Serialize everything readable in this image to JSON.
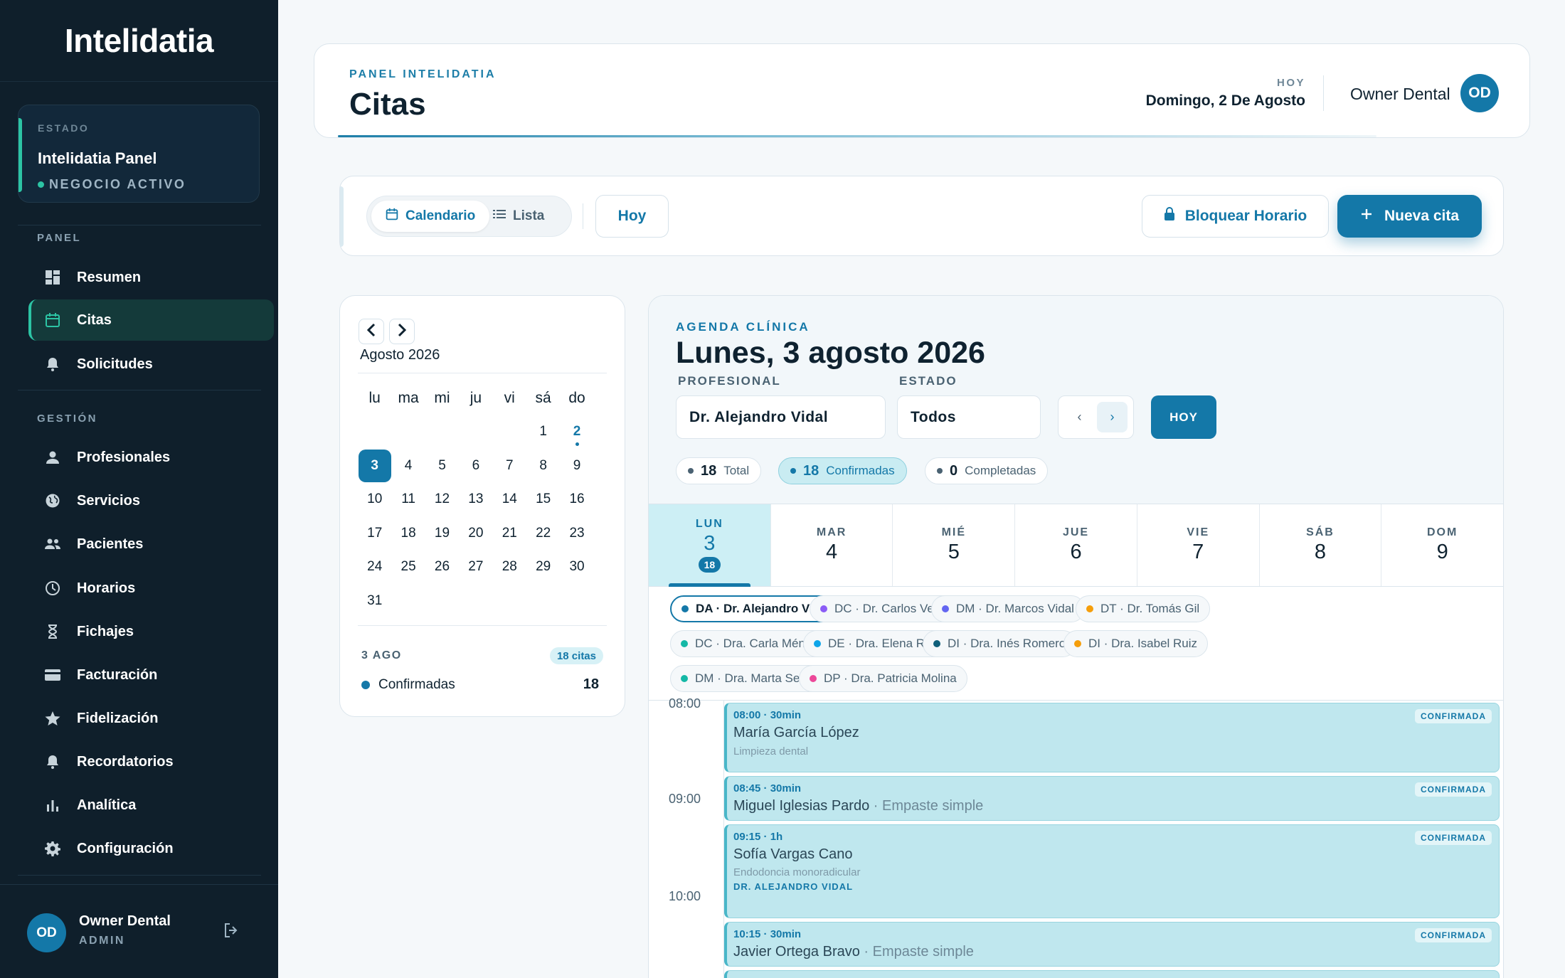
{
  "sidebar": {
    "logo": "Intelidatia",
    "status": {
      "label": "ESTADO",
      "name": "Intelidatia Panel",
      "badge": "NEGOCIO ACTIVO"
    },
    "panel_heading": "PANEL",
    "panel_items": [
      {
        "label": "Resumen",
        "icon": "dashboard-icon"
      },
      {
        "label": "Citas",
        "icon": "calendar-icon",
        "active": true
      },
      {
        "label": "Solicitudes",
        "icon": "bell-icon"
      }
    ],
    "gestion_heading": "GESTIÓN",
    "gestion_items": [
      {
        "label": "Profesionales",
        "icon": "person-icon"
      },
      {
        "label": "Servicios",
        "icon": "globe-icon"
      },
      {
        "label": "Pacientes",
        "icon": "people-icon"
      },
      {
        "label": "Horarios",
        "icon": "clock-icon"
      },
      {
        "label": "Fichajes",
        "icon": "hourglass-icon"
      },
      {
        "label": "Facturación",
        "icon": "card-icon"
      },
      {
        "label": "Fidelización",
        "icon": "star-icon"
      },
      {
        "label": "Recordatorios",
        "icon": "bell-icon"
      },
      {
        "label": "Analítica",
        "icon": "bar-chart-icon"
      },
      {
        "label": "Configuración",
        "icon": "gear-icon"
      }
    ],
    "footer": {
      "initials": "OD",
      "name": "Owner Dental",
      "role": "ADMIN"
    }
  },
  "header": {
    "eyebrow": "PANEL INTELIDATIA",
    "title": "Citas",
    "today_label": "HOY",
    "today_value": "Domingo, 2 De Agosto",
    "owner": "Owner Dental",
    "initials": "OD"
  },
  "toolbar": {
    "calendar": "Calendario",
    "list": "Lista",
    "today": "Hoy",
    "block": "Bloquear Horario",
    "new": "Nueva cita"
  },
  "mini_calendar": {
    "month": "Agosto 2026",
    "weekdays": [
      "lu",
      "ma",
      "mi",
      "ju",
      "vi",
      "sá",
      "do"
    ],
    "weeks": [
      [
        "",
        "",
        "",
        "",
        "",
        "1",
        "2"
      ],
      [
        "3",
        "4",
        "5",
        "6",
        "7",
        "8",
        "9"
      ],
      [
        "10",
        "11",
        "12",
        "13",
        "14",
        "15",
        "16"
      ],
      [
        "17",
        "18",
        "19",
        "20",
        "21",
        "22",
        "23"
      ],
      [
        "24",
        "25",
        "26",
        "27",
        "28",
        "29",
        "30"
      ],
      [
        "31",
        "",
        "",
        "",
        "",
        "",
        ""
      ]
    ],
    "selected": "3",
    "today": "2",
    "summary": {
      "date": "3 AGO",
      "badge": "18 citas",
      "label": "Confirmadas",
      "count": "18"
    }
  },
  "agenda": {
    "eyebrow": "AGENDA CLÍNICA",
    "title": "Lunes, 3 agosto 2026",
    "profesional_label": "PROFESIONAL",
    "profesional_value": "Dr. Alejandro Vidal",
    "estado_label": "ESTADO",
    "estado_value": "Todos",
    "today_btn": "HOY",
    "stats": [
      {
        "num": "18",
        "label": "Total"
      },
      {
        "num": "18",
        "label": "Confirmadas",
        "active": true
      },
      {
        "num": "0",
        "label": "Completadas"
      }
    ],
    "days": [
      {
        "name": "LUN",
        "num": "3",
        "count": "18",
        "active": true
      },
      {
        "name": "MAR",
        "num": "4"
      },
      {
        "name": "MIÉ",
        "num": "5"
      },
      {
        "name": "JUE",
        "num": "6"
      },
      {
        "name": "VIE",
        "num": "7"
      },
      {
        "name": "SÁB",
        "num": "8"
      },
      {
        "name": "DOM",
        "num": "9"
      }
    ],
    "professionals": [
      {
        "label": "DA · Dr. Alejandro Vidal",
        "color": "#1478a8",
        "active": true
      },
      {
        "label": "DC · Dr. Carlos Vega",
        "color": "#8b5cf6"
      },
      {
        "label": "DM · Dr. Marcos Vidal",
        "color": "#6366f1"
      },
      {
        "label": "DT · Dr. Tomás Gil",
        "color": "#f59e0b"
      },
      {
        "label": "DC · Dra. Carla Méndez",
        "color": "#14b8a6"
      },
      {
        "label": "DE · Dra. Elena Ruiz",
        "color": "#0ea5e9"
      },
      {
        "label": "DI · Dra. Inés Romero",
        "color": "#0f5f7a"
      },
      {
        "label": "DI · Dra. Isabel Ruiz",
        "color": "#f59e0b"
      },
      {
        "label": "DM · Dra. Marta Serrano",
        "color": "#14b8a6"
      },
      {
        "label": "DP · Dra. Patricia Molina",
        "color": "#ec4899"
      }
    ],
    "times": [
      "08:00",
      "09:00",
      "10:00"
    ],
    "appointments": [
      {
        "time": "08:00 · 30min",
        "patient": "María García López",
        "service": "",
        "sub": "Limpieza dental",
        "doctor": "",
        "status": "CONFIRMADA"
      },
      {
        "time": "08:45 · 30min",
        "patient": "Miguel Iglesias Pardo",
        "service": " · Empaste simple",
        "sub": "",
        "doctor": "",
        "status": "CONFIRMADA"
      },
      {
        "time": "09:15 · 1h",
        "patient": "Sofía Vargas Cano",
        "service": "",
        "sub": "Endodoncia monoradicular",
        "doctor": "DR. ALEJANDRO VIDAL",
        "status": "CONFIRMADA"
      },
      {
        "time": "10:15 · 30min",
        "patient": "Javier Ortega Bravo",
        "service": " · Empaste simple",
        "sub": "",
        "doctor": "",
        "status": "CONFIRMADA"
      }
    ]
  }
}
